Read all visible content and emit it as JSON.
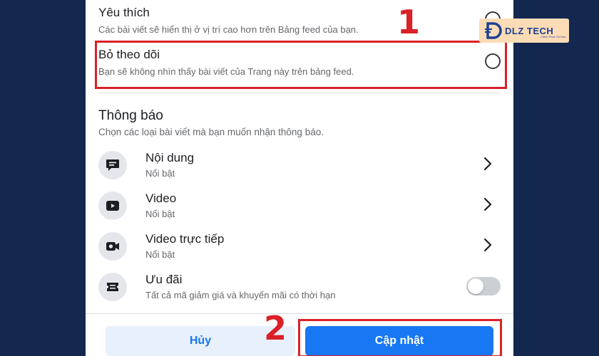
{
  "options": {
    "favorite": {
      "title": "Yêu thích",
      "desc": "Các bài viết sẽ hiển thị ở vị trí cao hơn trên Bảng feed của bạn."
    },
    "unfollow": {
      "title": "Bỏ theo dõi",
      "desc": "Bạn sẽ không nhìn thấy bài viết của Trang này trên bảng feed."
    }
  },
  "notifications": {
    "title": "Thông báo",
    "desc": "Chọn các loại bài viết mà bạn muốn nhận thông báo.",
    "items": [
      {
        "title": "Nội dung",
        "sub": "Nổi bật",
        "icon": "message-icon"
      },
      {
        "title": "Video",
        "sub": "Nổi bật",
        "icon": "video-play-icon"
      },
      {
        "title": "Video trực tiếp",
        "sub": "Nổi bật",
        "icon": "live-video-icon"
      },
      {
        "title": "Ưu đãi",
        "sub": "Tất cả mã giảm giá và khuyến mãi có thời hạn",
        "icon": "offer-tag-icon",
        "toggle_on": false
      }
    ]
  },
  "buttons": {
    "cancel": "Hủy",
    "update": "Cập nhật"
  },
  "annotations": {
    "step1": "1",
    "step2": "2"
  },
  "logo": {
    "text": "DLZ TECH",
    "tagline": "Chinh Phục Tin Học"
  },
  "colors": {
    "background": "#14284f",
    "accent": "#1877f2",
    "highlight": "#d92127"
  }
}
